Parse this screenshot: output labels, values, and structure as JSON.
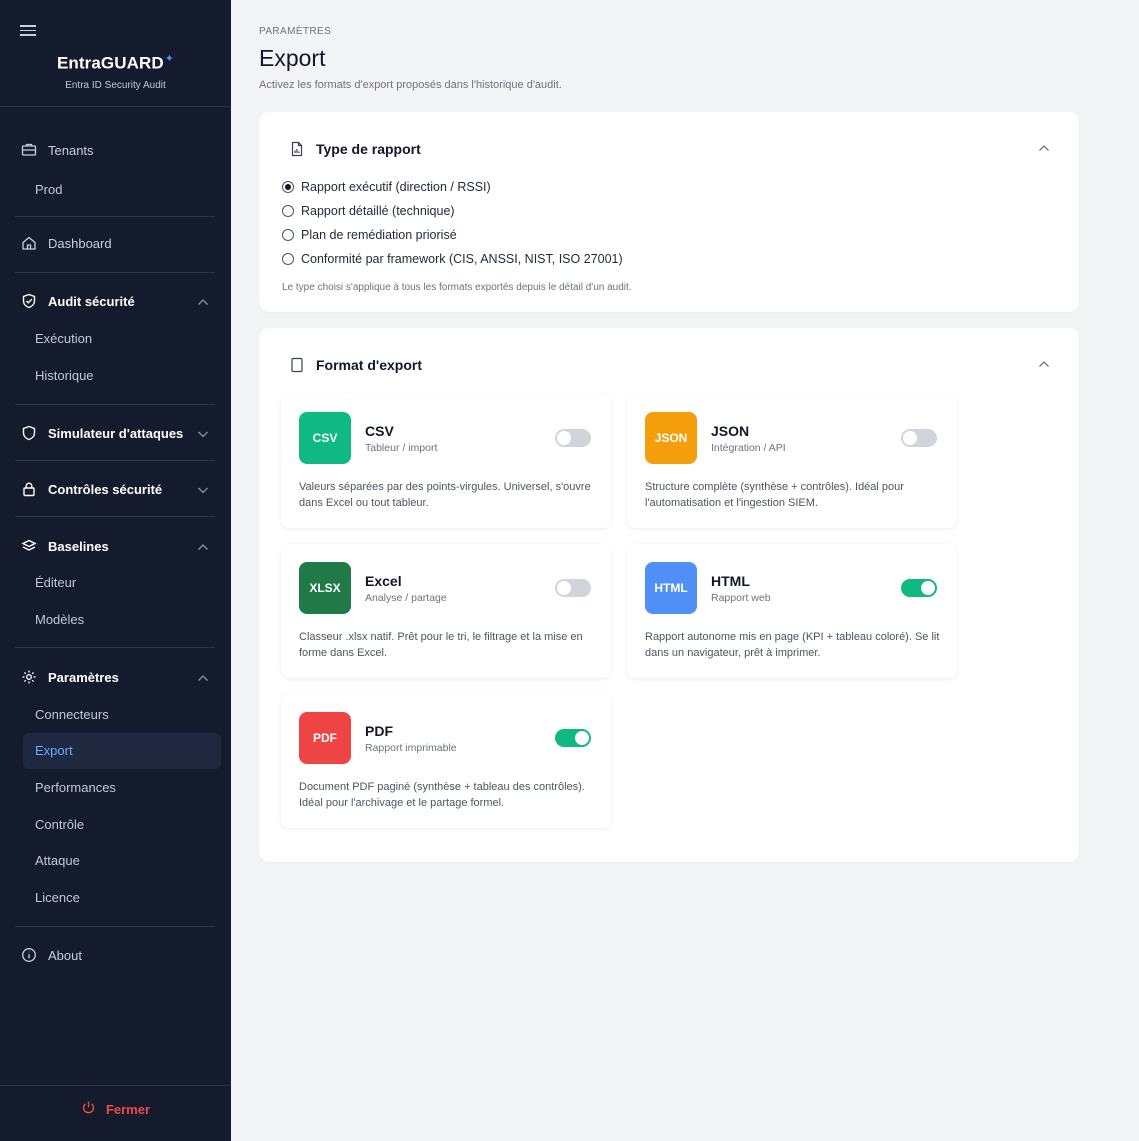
{
  "sidebar": {
    "brand": "EntraGUARD",
    "brand_sub": "Entra ID Security Audit",
    "tenants": "Tenants",
    "tenant_prod": "Prod",
    "dashboard": "Dashboard",
    "audit": "Audit sécurité",
    "audit_items": [
      "Exécution",
      "Historique"
    ],
    "simulateur": "Simulateur d'attaques",
    "controles": "Contrôles sécurité",
    "baselines": "Baselines",
    "baselines_items": [
      "Éditeur",
      "Modèles"
    ],
    "parametres": "Paramètres",
    "parametres_items": [
      "Connecteurs",
      "Export",
      "Performances",
      "Contrôle",
      "Attaque",
      "Licence"
    ],
    "about": "About",
    "fermer": "Fermer"
  },
  "header": {
    "breadcrumb": "PARAMÈTRES",
    "title": "Export",
    "description": "Activez les formats d'export proposés dans l'historique d'audit."
  },
  "report_type": {
    "title": "Type de rapport",
    "options": [
      "Rapport exécutif (direction / RSSI)",
      "Rapport détaillé (technique)",
      "Plan de remédiation priorisé",
      "Conformité par framework (CIS, ANSSI, NIST, ISO 27001)"
    ],
    "selected_index": 0,
    "hint": "Le type choisi s'applique à tous les formats exportés depuis le détail d'un audit."
  },
  "export_format": {
    "title": "Format d'export",
    "formats": [
      {
        "badge": "CSV",
        "name": "CSV",
        "sub": "Tableur / import",
        "desc": "Valeurs séparées par des points-virgules. Universel, s'ouvre dans Excel ou tout tableur.",
        "enabled": false,
        "color": "#10b981"
      },
      {
        "badge": "JSON",
        "name": "JSON",
        "sub": "Intégration / API",
        "desc": "Structure complète (synthèse + contrôles). Idéal pour l'automatisation et l'ingestion SIEM.",
        "enabled": false,
        "color": "#f59e0b"
      },
      {
        "badge": "XLSX",
        "name": "Excel",
        "sub": "Analyse / partage",
        "desc": "Classeur .xlsx natif. Prêt pour le tri, le filtrage et la mise en forme dans Excel.",
        "enabled": false,
        "color": "#1f7a47"
      },
      {
        "badge": "HTML",
        "name": "HTML",
        "sub": "Rapport web",
        "desc": "Rapport autonome mis en page (KPI + tableau coloré). Se lit dans un navigateur, prêt à imprimer.",
        "enabled": true,
        "color": "#4f8ff7"
      },
      {
        "badge": "PDF",
        "name": "PDF",
        "sub": "Rapport imprimable",
        "desc": "Document PDF paginé (synthèse + tableau des contrôles). Idéal pour l'archivage et le partage formel.",
        "enabled": true,
        "color": "#ef4444"
      }
    ]
  },
  "colors": {
    "sidebar_bg": "#141b2d",
    "accent_blue": "#4f8ff7",
    "toggle_on": "#10b981",
    "danger": "#ef4a4a"
  }
}
